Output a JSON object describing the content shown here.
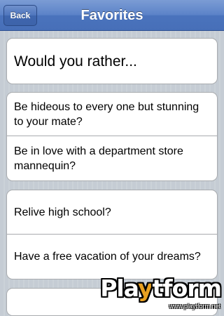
{
  "navbar": {
    "back_label": "Back",
    "title": "Favorites"
  },
  "groups": [
    {
      "cells": [
        {
          "text": "Would you rather..."
        }
      ]
    },
    {
      "cells": [
        {
          "text": "Be hideous to every one but stunning to your mate?"
        },
        {
          "text": "Be in love with a department store mannequin?"
        }
      ]
    },
    {
      "cells": [
        {
          "text": "Relive high school?"
        },
        {
          "text": "Have a free vacation of your dreams?"
        }
      ]
    }
  ],
  "watermark": {
    "logo_pre": "Pla",
    "logo_y": "y",
    "logo_post": "tform",
    "url": "www.playtform.net"
  }
}
